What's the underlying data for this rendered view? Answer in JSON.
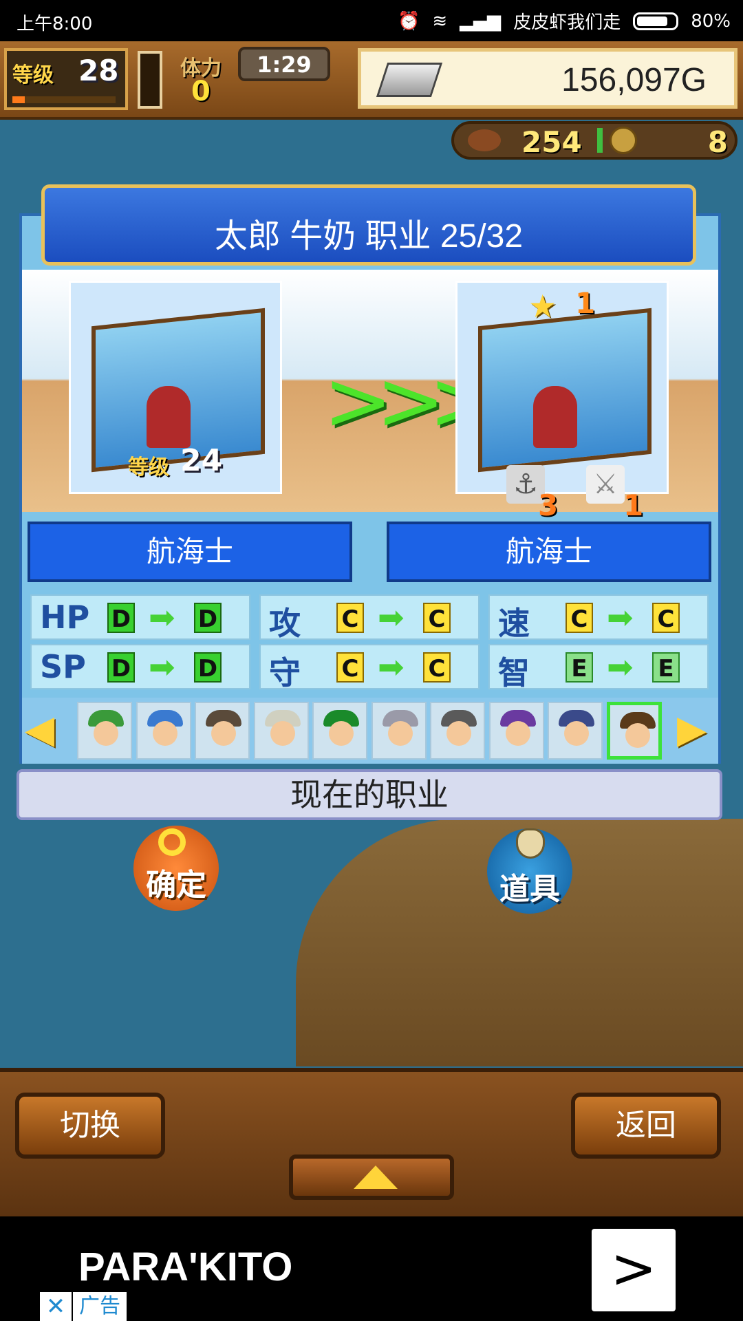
{
  "status_bar": {
    "time": "上午8:00",
    "carrier": "皮皮虾我们走",
    "battery": "80%",
    "icons": [
      "alarm-icon",
      "wifi-icon",
      "signal-icon",
      "battery-icon"
    ]
  },
  "hud": {
    "level_label": "等级",
    "level_value": "28",
    "level_progress": 0.12,
    "stamina_label": "体力",
    "stamina_value": "0",
    "timer": "1:29",
    "gold": "156,097G",
    "food": "254",
    "coins": "8"
  },
  "panel": {
    "title": "太郎 牛奶 职业 25/32",
    "from": {
      "level_label": "等级",
      "level": "24",
      "job": "航海士"
    },
    "to": {
      "stars": "1",
      "anchor_count": "3",
      "sword_count": "1",
      "job": "航海士"
    },
    "stats": [
      {
        "name": "HP",
        "from": "D",
        "to": "D"
      },
      {
        "name": "攻",
        "from": "C",
        "to": "C"
      },
      {
        "name": "速",
        "from": "C",
        "to": "C"
      },
      {
        "name": "SP",
        "from": "D",
        "to": "D"
      },
      {
        "name": "守",
        "from": "C",
        "to": "C"
      },
      {
        "name": "智",
        "from": "E",
        "to": "E"
      }
    ],
    "characters": [
      {
        "hat": "#3a9a3a"
      },
      {
        "hat": "#3a7ad0"
      },
      {
        "hat": "#5a4a3a"
      },
      {
        "hat": "#d0d0c0"
      },
      {
        "hat": "#1a8a2a"
      },
      {
        "hat": "#9a9aa8"
      },
      {
        "hat": "#5a5a5a"
      },
      {
        "hat": "#6a3aa0"
      },
      {
        "hat": "#3a4a8a"
      },
      {
        "hat": "#5a3a1a",
        "selected": true
      }
    ],
    "current_job_label": "现在的职业"
  },
  "actions": {
    "confirm": "确定",
    "items": "道具"
  },
  "bottom_bar": {
    "switch": "切换",
    "back": "返回"
  },
  "ad": {
    "brand": "PARA'KITO",
    "close": "✕",
    "tag": "广告"
  },
  "colors": {
    "accent_blue": "#1c62e6",
    "gold_text": "#ffd64a",
    "grade_green": "#38d030",
    "grade_yellow": "#ffe23a"
  }
}
